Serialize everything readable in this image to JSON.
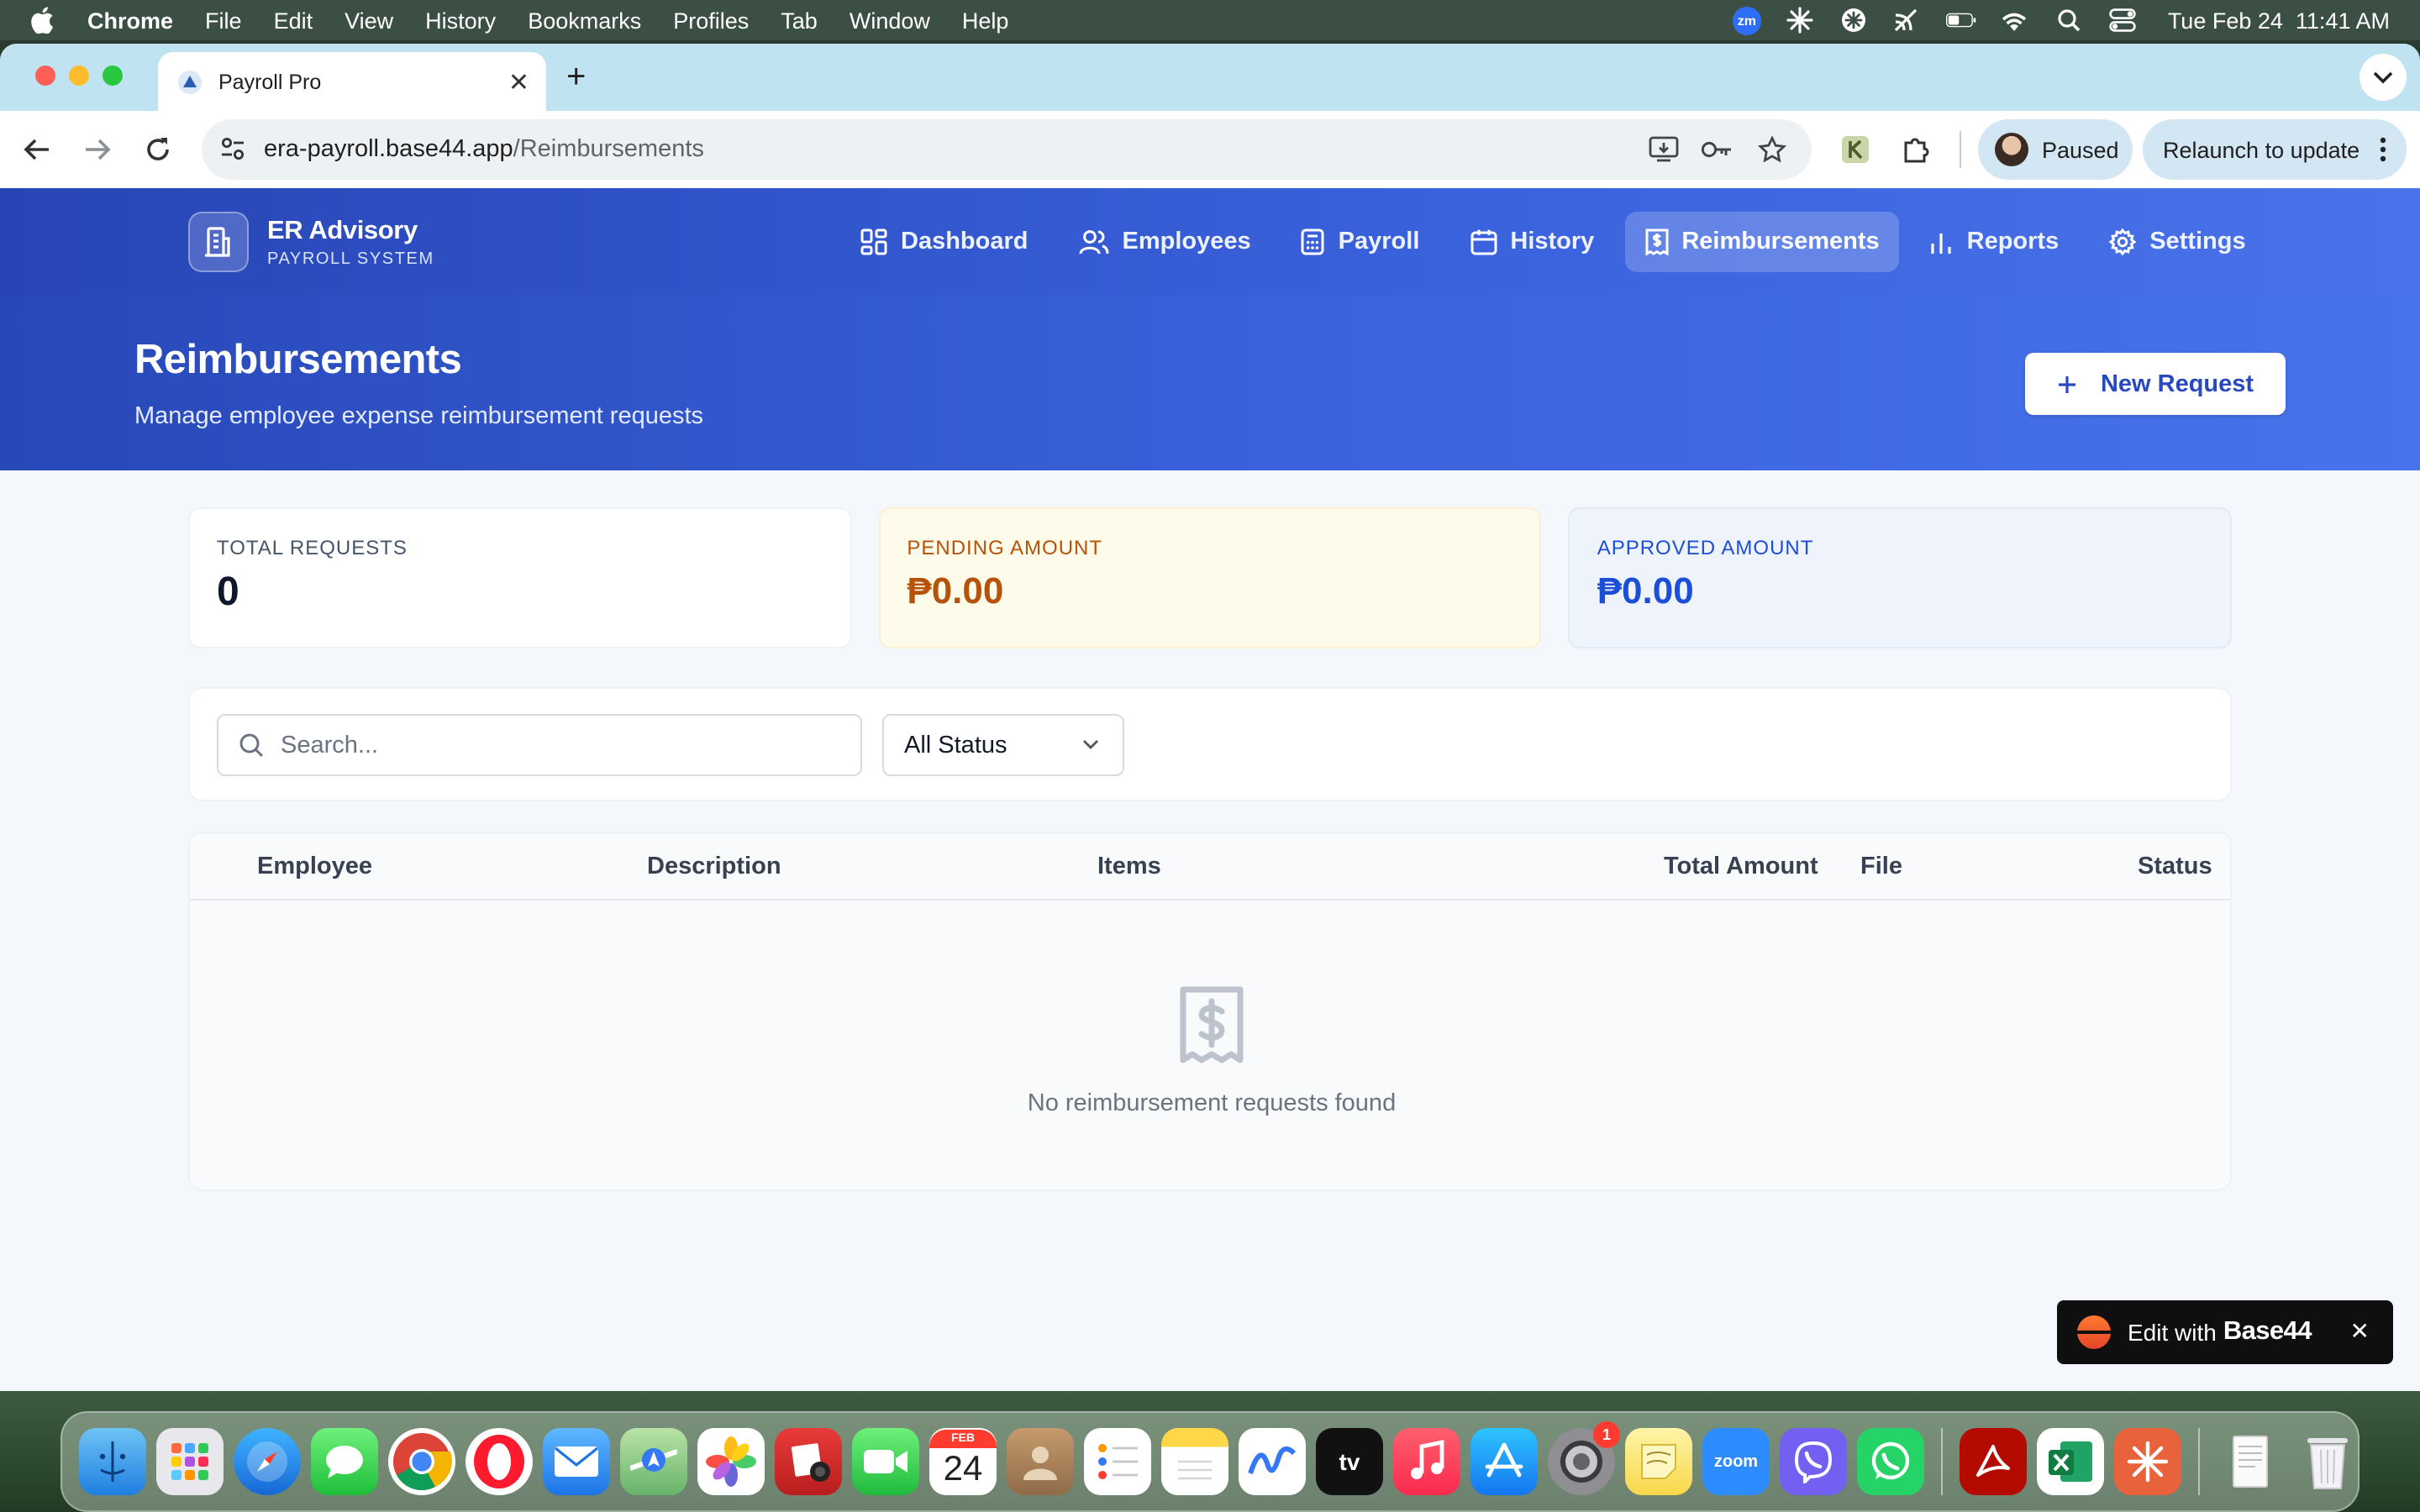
{
  "menubar": {
    "app_name": "Chrome",
    "items": [
      "File",
      "Edit",
      "View",
      "History",
      "Bookmarks",
      "Profiles",
      "Tab",
      "Window",
      "Help"
    ],
    "zoom_badge": "zm",
    "clock": "Tue Feb 24  11:41 AM"
  },
  "browser": {
    "tab_title": "Payroll Pro",
    "url_host": "era-payroll.base44.app",
    "url_path": "/Reimbursements",
    "profile_label": "Paused",
    "relaunch_label": "Relaunch to update"
  },
  "app": {
    "brand_name": "ER Advisory",
    "brand_sub": "PAYROLL SYSTEM",
    "nav": {
      "dashboard": "Dashboard",
      "employees": "Employees",
      "payroll": "Payroll",
      "history": "History",
      "reimbursements": "Reimbursements",
      "reports": "Reports",
      "settings": "Settings"
    },
    "active_nav": "Reimbursements",
    "page_title": "Reimbursements",
    "page_subtitle": "Manage employee expense reimbursement requests",
    "new_request_label": "New Request",
    "stats": {
      "total_label": "TOTAL REQUESTS",
      "total_value": "0",
      "pending_label": "PENDING AMOUNT",
      "pending_value": "₱0.00",
      "approved_label": "APPROVED AMOUNT",
      "approved_value": "₱0.00"
    },
    "search_placeholder": "Search...",
    "status_filter": "All Status",
    "table": {
      "col_employee": "Employee",
      "col_description": "Description",
      "col_items": "Items",
      "col_total": "Total Amount",
      "col_file": "File",
      "col_status": "Status"
    },
    "empty_message": "No reimbursement requests found",
    "edit_with_label": "Edit with",
    "edit_with_brand": "Base44"
  },
  "dock": {
    "calendar_month": "FEB",
    "calendar_day": "24",
    "tv_label": "tv",
    "zoom_label": "zoom",
    "settings_badge": "1"
  },
  "colors": {
    "brand_blue": "#2849c0",
    "pending_amber": "#b45309",
    "approved_blue": "#1d4ed8"
  }
}
